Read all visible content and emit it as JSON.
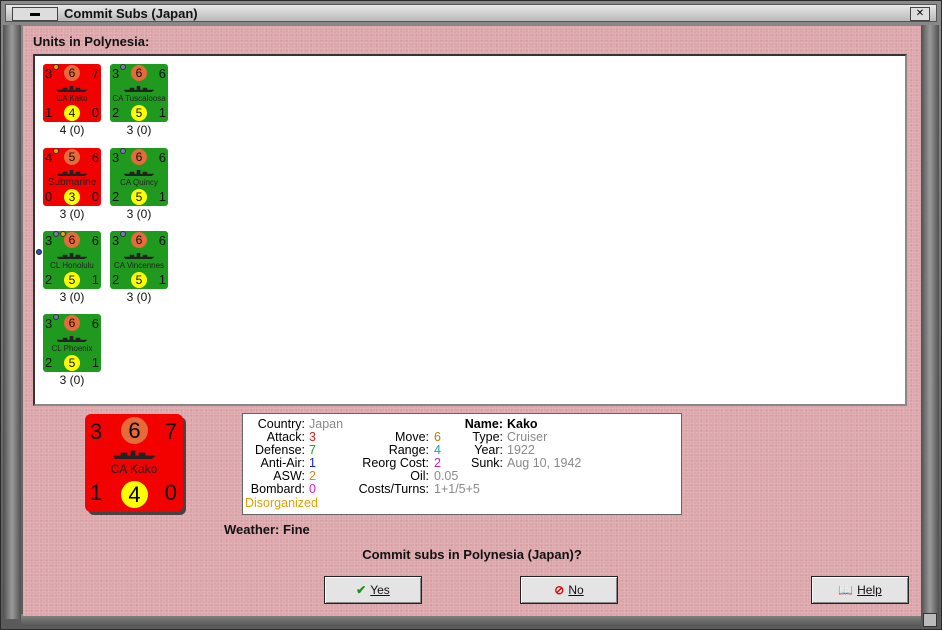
{
  "window": {
    "title": "Commit Subs (Japan)"
  },
  "units_label": "Units in Polynesia:",
  "units": [
    {
      "name": "CA Kako",
      "color": "red",
      "tl": "3",
      "tc": "6",
      "tr": "7",
      "bl": "1",
      "bc": "4",
      "br": "0",
      "caption": "4 (0)",
      "dots": [
        "orange"
      ],
      "side_dot": false
    },
    {
      "name": "CA Tuscaloosa",
      "color": "green",
      "tl": "3",
      "tc": "6",
      "tr": "6",
      "bl": "2",
      "bc": "5",
      "br": "1",
      "caption": "3 (0)",
      "dots": [
        "blue"
      ],
      "side_dot": false
    },
    {
      "name": "Submarine",
      "color": "red",
      "tl": "4",
      "tc": "5",
      "tr": "6",
      "bl": "0",
      "bc": "3",
      "br": "0",
      "caption": "3 (0)",
      "dots": [
        "orange"
      ],
      "side_dot": false
    },
    {
      "name": "CA Quincy",
      "color": "green",
      "tl": "3",
      "tc": "6",
      "tr": "6",
      "bl": "2",
      "bc": "5",
      "br": "1",
      "caption": "3 (0)",
      "dots": [
        "blue"
      ],
      "side_dot": false
    },
    {
      "name": "CL Honolulu",
      "color": "green",
      "tl": "3",
      "tc": "6",
      "tr": "6",
      "bl": "2",
      "bc": "5",
      "br": "1",
      "caption": "3 (0)",
      "dots": [
        "blue",
        "orange"
      ],
      "side_dot": true
    },
    {
      "name": "CA Vincennes",
      "color": "green",
      "tl": "3",
      "tc": "6",
      "tr": "6",
      "bl": "2",
      "bc": "5",
      "br": "1",
      "caption": "3 (0)",
      "dots": [
        "blue"
      ],
      "side_dot": false
    },
    {
      "name": "CL Phoenix",
      "color": "green",
      "tl": "3",
      "tc": "6",
      "tr": "6",
      "bl": "2",
      "bc": "5",
      "br": "1",
      "caption": "3 (0)",
      "dots": [
        "blue"
      ],
      "side_dot": false
    }
  ],
  "selected": {
    "name": "CA Kako",
    "tl": "3",
    "tc": "6",
    "tr": "7",
    "bl": "1",
    "bc": "4",
    "br": "0"
  },
  "info": {
    "country_label": "Country:",
    "country": "Japan",
    "attack_label": "Attack:",
    "attack": "3",
    "defense_label": "Defense:",
    "defense": "7",
    "antiair_label": "Anti-Air:",
    "antiair": "1",
    "asw_label": "ASW:",
    "asw": "2",
    "bombard_label": "Bombard:",
    "bombard": "0",
    "status": "Disorganized",
    "move_label": "Move:",
    "move": "6",
    "range_label": "Range:",
    "range": "4",
    "reorg_label": "Reorg Cost:",
    "reorg": "2",
    "oil_label": "Oil:",
    "oil": "0.05",
    "costs_label": "Costs/Turns:",
    "costs": "1+1/5+5",
    "name_label": "Name:",
    "name": "Kako",
    "type_label": "Type:",
    "type": "Cruiser",
    "year_label": "Year:",
    "year": "1922",
    "sunk_label": "Sunk:",
    "sunk": "Aug 10, 1942"
  },
  "weather_label": "Weather:",
  "weather": "Fine",
  "question": "Commit subs in Polynesia (Japan)?",
  "buttons": {
    "yes": "Yes",
    "no": "No",
    "help": "Help"
  },
  "colors": {
    "attack": "#e02020",
    "defense": "#20a020",
    "antiair": "#2020c0",
    "asw": "#e08020",
    "bombard": "#d020d0",
    "move": "#b08000",
    "range": "#20a0a0",
    "reorg": "#c020c0",
    "grey": "#8a8a8a",
    "status": "#e0a000"
  }
}
